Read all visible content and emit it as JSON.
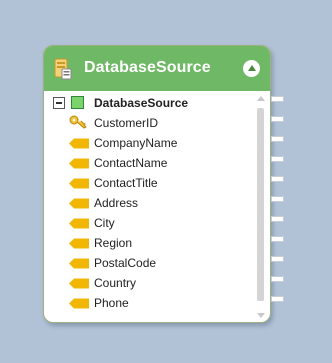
{
  "node": {
    "title": "DatabaseSource",
    "header_color": "#6fb865",
    "icon": "database-icon",
    "collapse_icon": "collapse-up-icon"
  },
  "tree": {
    "root": {
      "label": "DatabaseSource",
      "expander_icon": "minus-expander-icon",
      "icon": "table-icon"
    },
    "fields": [
      {
        "label": "CustomerID",
        "icon": "key-icon"
      },
      {
        "label": "CompanyName",
        "icon": "field-icon"
      },
      {
        "label": "ContactName",
        "icon": "field-icon"
      },
      {
        "label": "ContactTitle",
        "icon": "field-icon"
      },
      {
        "label": "Address",
        "icon": "field-icon"
      },
      {
        "label": "City",
        "icon": "field-icon"
      },
      {
        "label": "Region",
        "icon": "field-icon"
      },
      {
        "label": "PostalCode",
        "icon": "field-icon"
      },
      {
        "label": "Country",
        "icon": "field-icon"
      },
      {
        "label": "Phone",
        "icon": "field-icon"
      }
    ]
  },
  "colors": {
    "background": "#b1c2d6",
    "field_icon": "#f0b400",
    "key_icon": "#e8b000"
  }
}
